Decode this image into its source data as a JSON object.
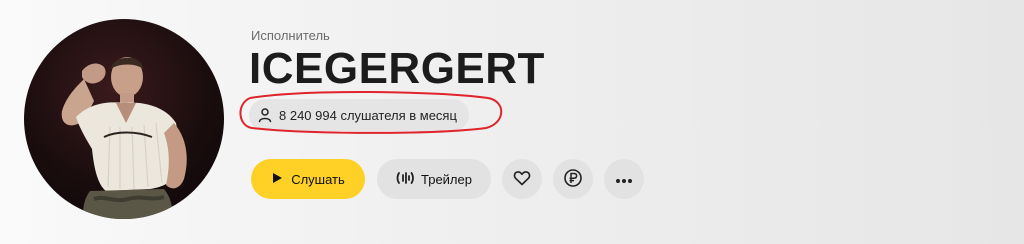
{
  "artist": {
    "kicker": "Исполнитель",
    "name": "ICEGERGERT",
    "listeners_text": "8 240 994 слушателя в месяц"
  },
  "actions": {
    "play_label": "Слушать",
    "trailer_label": "Трейлер"
  },
  "icons": {
    "listeners": "person-icon",
    "play": "play-icon",
    "trailer": "equalizer-icon",
    "like": "heart-icon",
    "donate": "ruble-icon",
    "more": "ellipsis-icon"
  },
  "colors": {
    "accent": "#ffd026",
    "button_bg": "#e2e2e2",
    "annotation": "#e0242b",
    "text": "#1c1c1c"
  }
}
